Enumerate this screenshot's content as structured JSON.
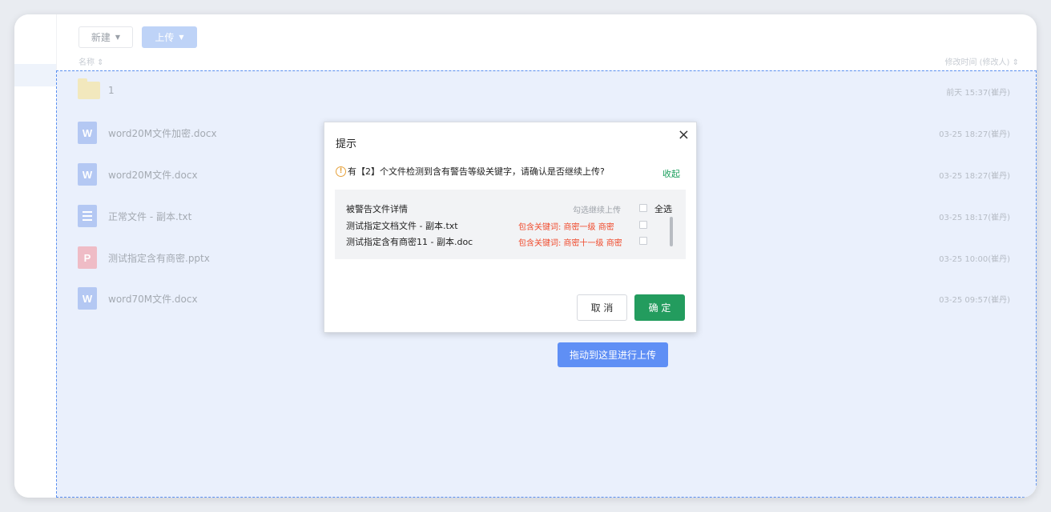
{
  "toolbar": {
    "new_label": "新建",
    "upload_label": "上传"
  },
  "columns": {
    "name": "名称 ⇕",
    "modified": "修改时间 (修改人) ⇕"
  },
  "files": [
    {
      "name": "1",
      "time": "前天 15:37(崔丹)",
      "icon": "folder-icon",
      "type": "folder",
      "glyph": ""
    },
    {
      "name": "word20M文件加密.docx",
      "time": "03-25 18:27(崔丹)",
      "icon": "word-file-icon",
      "type": "word",
      "glyph": "W"
    },
    {
      "name": "word20M文件.docx",
      "time": "03-25 18:27(崔丹)",
      "icon": "word-file-icon",
      "type": "word",
      "glyph": "W"
    },
    {
      "name": "正常文件 - 副本.txt",
      "time": "03-25 18:17(崔丹)",
      "icon": "text-file-icon",
      "type": "txt",
      "glyph": ""
    },
    {
      "name": "测试指定含有商密.pptx",
      "time": "03-25 10:00(崔丹)",
      "icon": "powerpoint-file-icon",
      "type": "ppt",
      "glyph": "P"
    },
    {
      "name": "word70M文件.docx",
      "time": "03-25 09:57(崔丹)",
      "icon": "word-file-icon",
      "type": "word",
      "glyph": "W"
    }
  ],
  "dropzone": {
    "button_label": "拖动到这里进行上传"
  },
  "dialog": {
    "title": "提示",
    "close_glyph": "×",
    "warning_message": "有【2】个文件检测到含有警告等级关键字，请确认是否继续上传?",
    "collapse_label": "收起",
    "detail_title": "被警告文件详情",
    "check_hint": "勾选继续上传",
    "select_all_label": "全选",
    "warned_files": [
      {
        "name": "测试指定文档文件 - 副本.txt",
        "keywords": "包含关键词: 商密一级 商密"
      },
      {
        "name": "测试指定含有商密11 - 副本.doc",
        "keywords": "包含关键词: 商密十一级 商密"
      }
    ],
    "cancel_label": "取 消",
    "ok_label": "确 定"
  },
  "colors": {
    "accent_blue": "#5f8ff5",
    "confirm_green": "#239c5e",
    "link_green": "#1a9f5c",
    "warning_orange": "#e6a23c",
    "keyword_red": "#f04a2c",
    "dropzone_bg": "#eaf0fc"
  }
}
